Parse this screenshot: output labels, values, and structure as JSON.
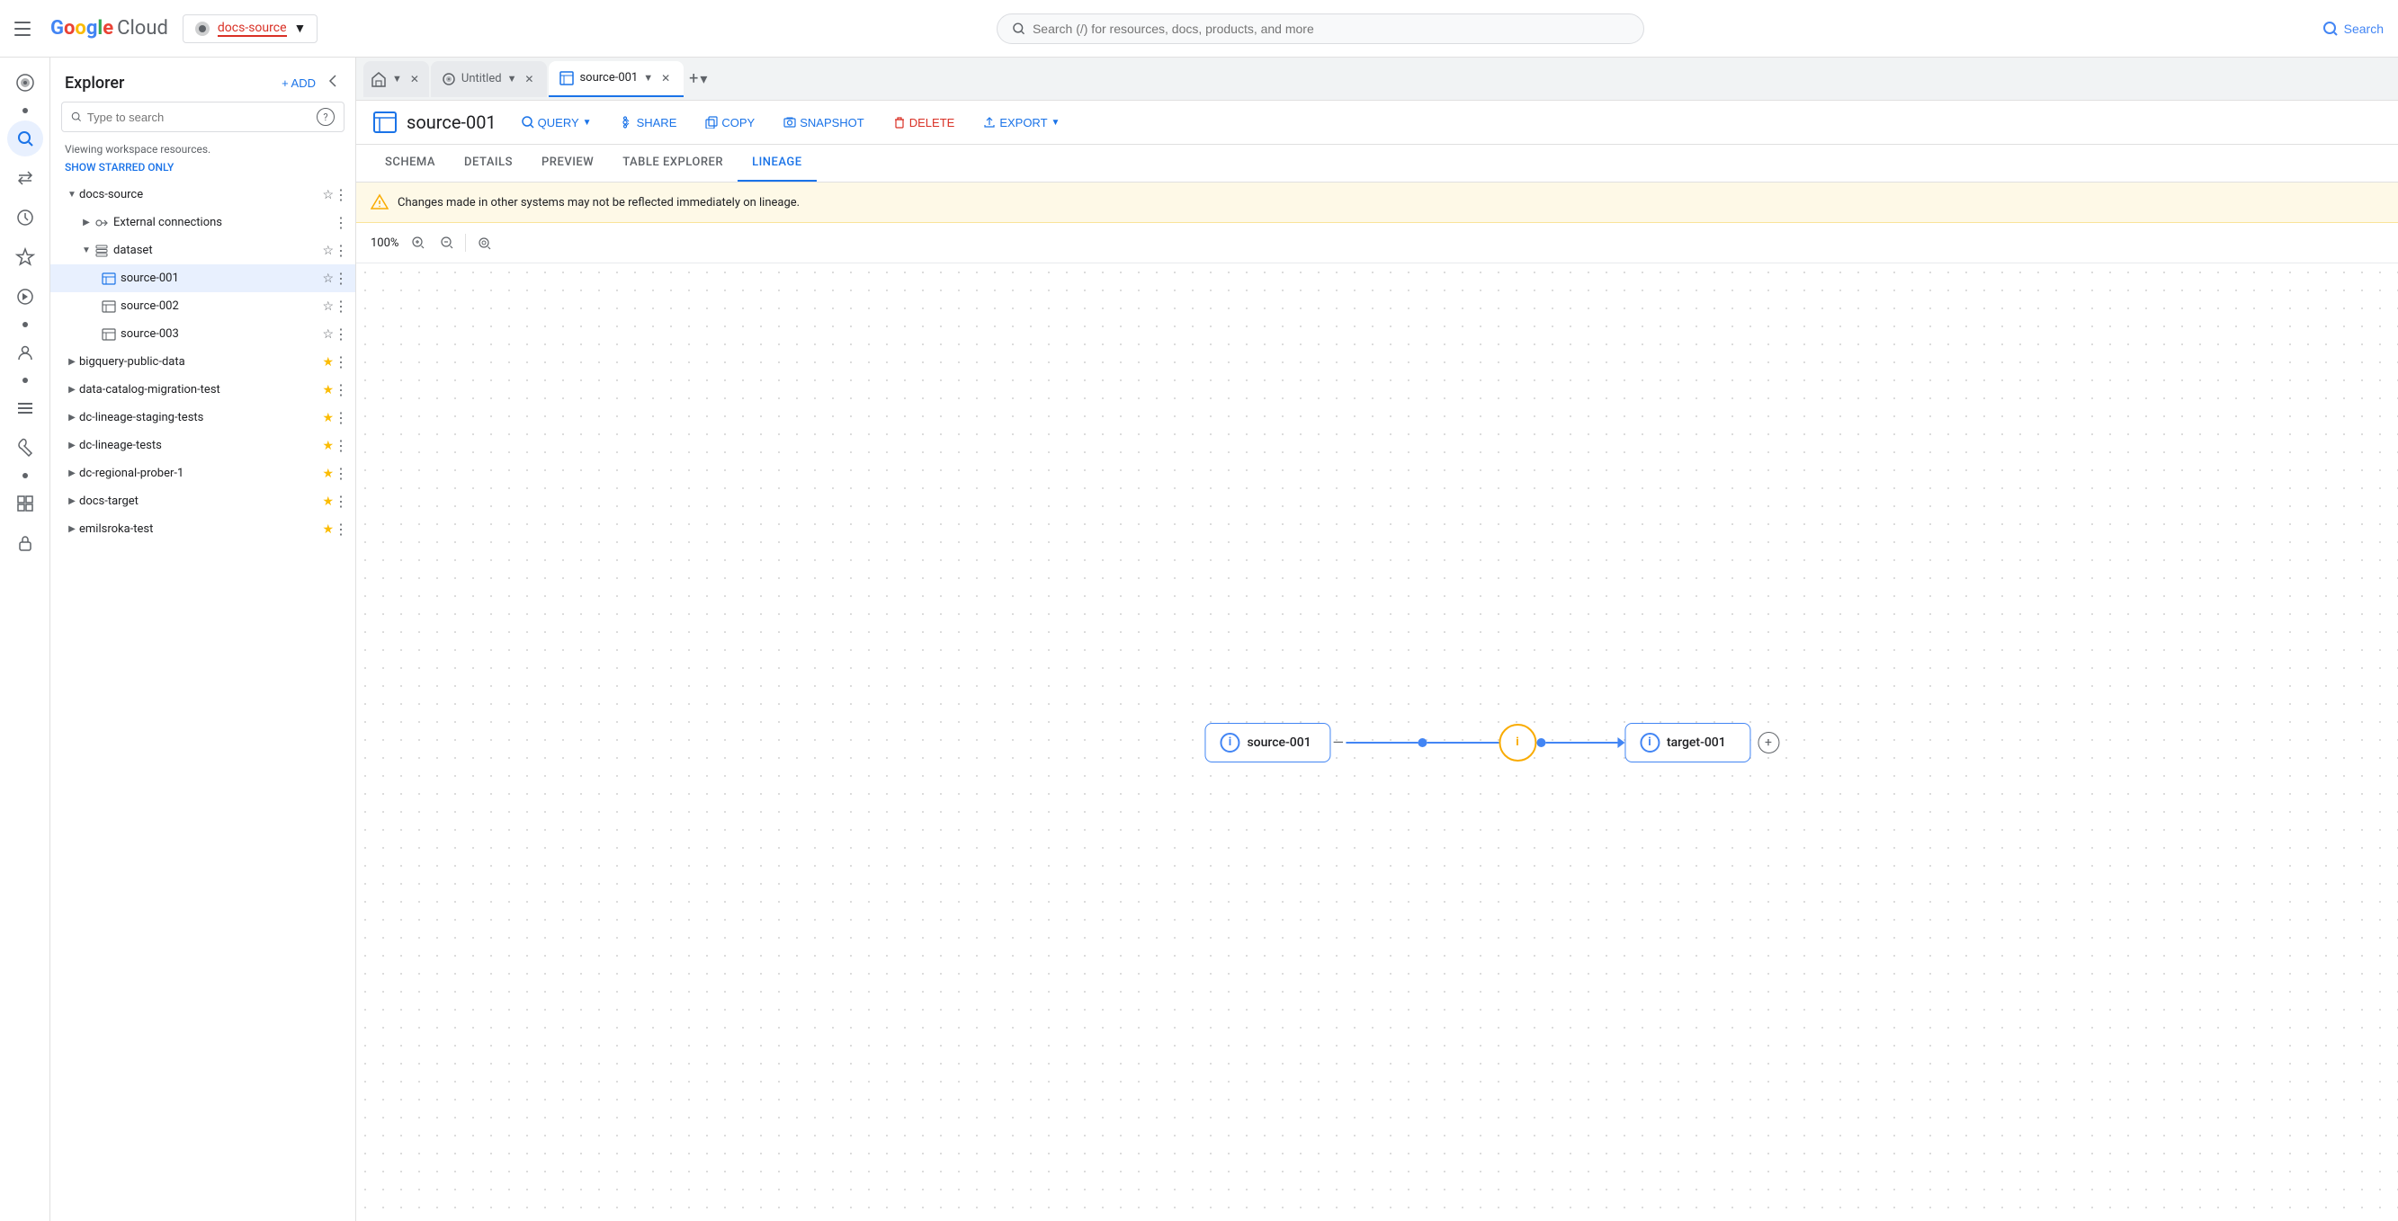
{
  "topNav": {
    "hamburger_label": "Main menu",
    "logo": {
      "letters": [
        "G",
        "o",
        "o",
        "g",
        "l",
        "e"
      ],
      "colors": [
        "#4285f4",
        "#ea4335",
        "#fbbc05",
        "#4285f4",
        "#34a853",
        "#ea4335"
      ],
      "cloud": " Cloud"
    },
    "project": {
      "icon": "⚙",
      "name": "docs-source",
      "arrow": "▼"
    },
    "search": {
      "placeholder": "Search (/) for resources, docs, products, and more",
      "button_label": "Search",
      "icon": "🔍"
    }
  },
  "iconSidebar": {
    "items": [
      {
        "icon": "☰",
        "name": "menu-icon",
        "active": false
      },
      {
        "icon": "⊙",
        "name": "bigquery-icon",
        "active": false
      },
      {
        "icon": "⇄",
        "name": "transfers-icon",
        "active": false
      },
      {
        "icon": "🕐",
        "name": "history-icon",
        "active": false
      },
      {
        "icon": "✦",
        "name": "starred-icon",
        "active": false
      },
      {
        "icon": "⚙",
        "name": "scheduled-icon",
        "active": false
      },
      {
        "icon": "•",
        "name": "dot1",
        "active": false
      },
      {
        "icon": "≡",
        "name": "list-icon",
        "active": false
      },
      {
        "icon": "🔧",
        "name": "tools-icon",
        "active": false
      },
      {
        "icon": "•",
        "name": "dot2",
        "active": false
      },
      {
        "icon": "⊞",
        "name": "grid-icon",
        "active": false
      },
      {
        "icon": "🔒",
        "name": "lock-icon",
        "active": false
      }
    ]
  },
  "explorer": {
    "title": "Explorer",
    "add_label": "+ ADD",
    "collapse_icon": "◀",
    "search_placeholder": "Type to search",
    "help_icon": "?",
    "viewing_text": "Viewing workspace resources.",
    "show_starred": "SHOW STARRED ONLY",
    "tree": [
      {
        "id": "docs-source",
        "label": "docs-source",
        "indent": 1,
        "arrow": "▼",
        "icon": "arrow",
        "star": "empty",
        "more": true,
        "children": [
          {
            "id": "external-connections",
            "label": "External connections",
            "indent": 2,
            "arrow": "▶",
            "icon": "⇢",
            "star": false,
            "more": true
          },
          {
            "id": "dataset",
            "label": "dataset",
            "indent": 2,
            "arrow": "▼",
            "icon": "table",
            "star": "empty",
            "more": true,
            "children": [
              {
                "id": "source-001",
                "label": "source-001",
                "indent": 3,
                "icon": "table",
                "star": "empty",
                "more": true,
                "selected": true
              },
              {
                "id": "source-002",
                "label": "source-002",
                "indent": 3,
                "icon": "table",
                "star": "empty",
                "more": true
              },
              {
                "id": "source-003",
                "label": "source-003",
                "indent": 3,
                "icon": "table",
                "star": "empty",
                "more": true
              }
            ]
          }
        ]
      },
      {
        "id": "bigquery-public-data",
        "label": "bigquery-public-data",
        "indent": 1,
        "arrow": "▶",
        "star": "filled",
        "more": true
      },
      {
        "id": "data-catalog-migration-test",
        "label": "data-catalog-migration-test",
        "indent": 1,
        "arrow": "▶",
        "star": "filled",
        "more": true
      },
      {
        "id": "dc-lineage-staging-tests",
        "label": "dc-lineage-staging-tests",
        "indent": 1,
        "arrow": "▶",
        "star": "filled",
        "more": true
      },
      {
        "id": "dc-lineage-tests",
        "label": "dc-lineage-tests",
        "indent": 1,
        "arrow": "▶",
        "star": "filled",
        "more": true
      },
      {
        "id": "dc-regional-prober-1",
        "label": "dc-regional-prober-1",
        "indent": 1,
        "arrow": "▶",
        "star": "filled",
        "more": true
      },
      {
        "id": "docs-target",
        "label": "docs-target",
        "indent": 1,
        "arrow": "▶",
        "star": "filled",
        "more": true
      },
      {
        "id": "emilsroka-test",
        "label": "emilsroka-test",
        "indent": 1,
        "arrow": "▶",
        "star": "filled",
        "more": true
      }
    ]
  },
  "tabs": [
    {
      "id": "home",
      "type": "home",
      "icon": "⌂",
      "active": false
    },
    {
      "id": "untitled",
      "label": "Untitled",
      "icon": "⊙",
      "active": false,
      "closeable": true,
      "dropdown": true
    },
    {
      "id": "source-001",
      "label": "source-001",
      "icon": "table",
      "active": true,
      "closeable": true,
      "dropdown": true
    }
  ],
  "tabAdd": "+",
  "tabMore": "▾",
  "toolbar": {
    "table_icon": "⊞",
    "table_name": "source-001",
    "buttons": [
      {
        "id": "query",
        "label": "QUERY",
        "icon": "🔍",
        "dropdown": true
      },
      {
        "id": "share",
        "label": "SHARE",
        "icon": "👥"
      },
      {
        "id": "copy",
        "label": "COPY",
        "icon": "📋"
      },
      {
        "id": "snapshot",
        "label": "SNAPSHOT",
        "icon": "📸"
      },
      {
        "id": "delete",
        "label": "DELETE",
        "icon": "🗑",
        "danger": true
      },
      {
        "id": "export",
        "label": "EXPORT",
        "icon": "⬆",
        "dropdown": true
      }
    ]
  },
  "subTabs": [
    {
      "id": "schema",
      "label": "SCHEMA",
      "active": false
    },
    {
      "id": "details",
      "label": "DETAILS",
      "active": false
    },
    {
      "id": "preview",
      "label": "PREVIEW",
      "active": false
    },
    {
      "id": "table-explorer",
      "label": "TABLE EXPLORER",
      "active": false
    },
    {
      "id": "lineage",
      "label": "LINEAGE",
      "active": true
    }
  ],
  "warning": {
    "icon": "⚠",
    "text": "Changes made in other systems may not be reflected immediately on lineage."
  },
  "zoom": {
    "level": "100%",
    "zoom_in": "+",
    "zoom_out": "−",
    "reset": "⊡"
  },
  "lineage": {
    "nodes": [
      {
        "id": "source-001",
        "label": "source-001",
        "type": "source"
      },
      {
        "id": "transform",
        "label": "",
        "type": "transform"
      },
      {
        "id": "target-001",
        "label": "target-001",
        "type": "target"
      }
    ]
  }
}
